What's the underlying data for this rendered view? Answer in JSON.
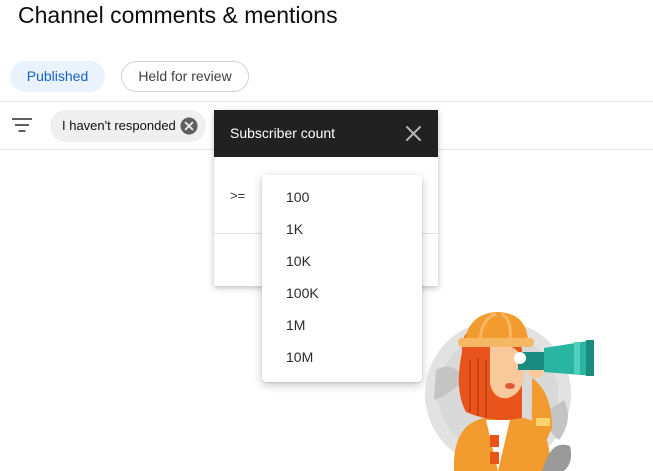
{
  "page": {
    "title": "Channel comments & mentions"
  },
  "tabs": [
    {
      "label": "Published",
      "selected": true
    },
    {
      "label": "Held for review",
      "selected": false
    }
  ],
  "filter_bar": {
    "filter_icon": "filter-list-icon",
    "chip": {
      "label": "I haven't responded",
      "remove_icon": "cancel-circle-icon"
    }
  },
  "dialog": {
    "title": "Subscriber count",
    "close_icon": "close-icon",
    "operator": ">="
  },
  "dropdown": {
    "options": [
      "100",
      "1K",
      "10K",
      "100K",
      "1M",
      "10M"
    ]
  },
  "illustration": {
    "name": "explorer-with-binoculars-illustration"
  },
  "colors": {
    "accent_blue": "#1565c0",
    "tab_selected_bg": "#e9f2fd",
    "dialog_header_bg": "#212121",
    "chip_bg": "#efefef"
  }
}
